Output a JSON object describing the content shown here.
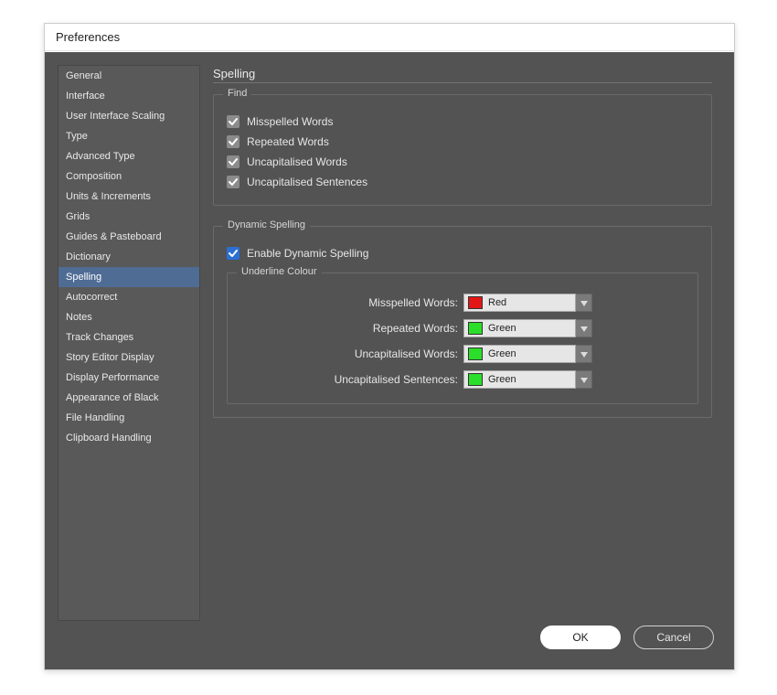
{
  "dialog": {
    "title": "Preferences"
  },
  "sidebar": {
    "items": [
      "General",
      "Interface",
      "User Interface Scaling",
      "Type",
      "Advanced Type",
      "Composition",
      "Units & Increments",
      "Grids",
      "Guides & Pasteboard",
      "Dictionary",
      "Spelling",
      "Autocorrect",
      "Notes",
      "Track Changes",
      "Story Editor Display",
      "Display Performance",
      "Appearance of Black",
      "File Handling",
      "Clipboard Handling"
    ],
    "selected_index": 10
  },
  "panel": {
    "title": "Spelling",
    "find": {
      "legend": "Find",
      "items": [
        {
          "label": "Misspelled Words",
          "checked": true
        },
        {
          "label": "Repeated Words",
          "checked": true
        },
        {
          "label": "Uncapitalised Words",
          "checked": true
        },
        {
          "label": "Uncapitalised Sentences",
          "checked": true
        }
      ]
    },
    "dynamic": {
      "legend": "Dynamic Spelling",
      "enable": {
        "label": "Enable Dynamic Spelling",
        "checked": true
      },
      "underline": {
        "legend": "Underline Colour",
        "rows": [
          {
            "label": "Misspelled Words:",
            "color_name": "Red",
            "color_hex": "#e21617"
          },
          {
            "label": "Repeated Words:",
            "color_name": "Green",
            "color_hex": "#2ade2a"
          },
          {
            "label": "Uncapitalised Words:",
            "color_name": "Green",
            "color_hex": "#2ade2a"
          },
          {
            "label": "Uncapitalised Sentences:",
            "color_name": "Green",
            "color_hex": "#2ade2a"
          }
        ]
      }
    }
  },
  "buttons": {
    "ok": "OK",
    "cancel": "Cancel"
  }
}
